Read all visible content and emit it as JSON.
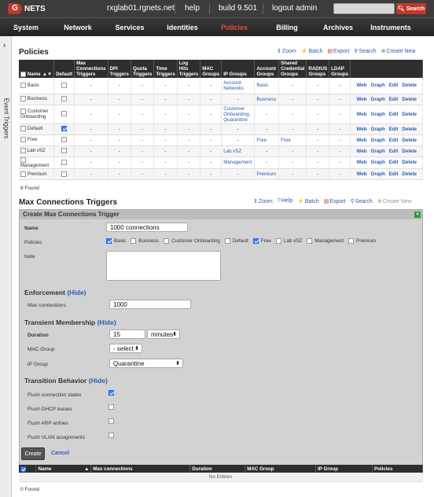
{
  "topbar": {
    "brand_letter": "G",
    "brand_text": "NETS",
    "host": "rxglab01.rgnets.net",
    "help": "help",
    "build": "build 9.501",
    "logout": "logout admin",
    "search_btn": "Search"
  },
  "nav": [
    "System",
    "Network",
    "Services",
    "Identities",
    "Policies",
    "Billing",
    "Archives",
    "Instruments"
  ],
  "nav_active": "Policies",
  "sidetab": {
    "arrow": "›",
    "label": "Event Triggers"
  },
  "policies": {
    "title": "Policies",
    "toolbar": [
      "Zoom",
      "Batch",
      "Export",
      "Search",
      "Create New"
    ],
    "headers": [
      "Name",
      "Default",
      "Max Connections Triggers",
      "DPI Triggers",
      "Quota Triggers",
      "Time Triggers",
      "Log Hits Triggers",
      "MAC Groups",
      "IP Groups",
      "Account Groups",
      "Shared Credential Groups",
      "RADIUS Groups",
      "LDAP Groups"
    ],
    "rows": [
      {
        "name": "Basic",
        "default": false,
        "cells": [
          "-",
          "-",
          "-",
          "-",
          "-",
          "-"
        ],
        "ip": "Account Networks",
        "acct": "Basic",
        "shared": "-",
        "radius": "-",
        "ldap": "-"
      },
      {
        "name": "Business",
        "default": false,
        "cells": [
          "-",
          "-",
          "-",
          "-",
          "-",
          "-"
        ],
        "ip": "-",
        "acct": "Business",
        "shared": "-",
        "radius": "-",
        "ldap": "-"
      },
      {
        "name": "Customer Onboarding",
        "default": false,
        "cells": [
          "-",
          "-",
          "-",
          "-",
          "-",
          "-"
        ],
        "ip": "Customer Onboarding, Quarantine",
        "acct": "-",
        "shared": "-",
        "radius": "-",
        "ldap": "-"
      },
      {
        "name": "Default",
        "default": true,
        "cells": [
          "-",
          "-",
          "-",
          "-",
          "-",
          "-"
        ],
        "ip": "-",
        "acct": "-",
        "shared": "-",
        "radius": "-",
        "ldap": "-"
      },
      {
        "name": "Free",
        "default": false,
        "cells": [
          "-",
          "-",
          "-",
          "-",
          "-",
          "-"
        ],
        "ip": "-",
        "acct": "Free",
        "shared": "Free",
        "radius": "-",
        "ldap": "-"
      },
      {
        "name": "Lab vSZ",
        "default": false,
        "cells": [
          "-",
          "-",
          "-",
          "-",
          "-",
          "-"
        ],
        "ip": "Lab vSZ",
        "acct": "-",
        "shared": "-",
        "radius": "-",
        "ldap": "-"
      },
      {
        "name": "Management",
        "default": false,
        "cells": [
          "-",
          "-",
          "-",
          "-",
          "-",
          "-"
        ],
        "ip": "Management",
        "acct": "-",
        "shared": "-",
        "radius": "-",
        "ldap": "-"
      },
      {
        "name": "Premium",
        "default": false,
        "cells": [
          "-",
          "-",
          "-",
          "-",
          "-",
          "-"
        ],
        "ip": "-",
        "acct": "Premium",
        "shared": "-",
        "radius": "-",
        "ldap": "-"
      }
    ],
    "actions": [
      "Web",
      "Graph",
      "Edit",
      "Delete"
    ],
    "found": "8 Found"
  },
  "mct": {
    "title": "Max Connections Triggers",
    "toolbar": [
      "Zoom",
      "Help",
      "Batch",
      "Export",
      "Search",
      "Create New"
    ],
    "form_title": "Create Max Connections Trigger",
    "name_label": "Name",
    "name_value": "1000 connections",
    "policies_label": "Policies",
    "policy_options": [
      {
        "label": "Basic",
        "checked": true
      },
      {
        "label": "Business",
        "checked": false
      },
      {
        "label": "Customer Onboarding",
        "checked": false
      },
      {
        "label": "Default",
        "checked": false
      },
      {
        "label": "Free",
        "checked": true
      },
      {
        "label": "Lab vSZ",
        "checked": false
      },
      {
        "label": "Management",
        "checked": false
      },
      {
        "label": "Premium",
        "checked": false
      }
    ],
    "note_label": "Note",
    "enforcement_title": "Enforcement",
    "hide": "(Hide)",
    "max_conn_label": "Max connections",
    "max_conn_value": "1000",
    "transient_title": "Transient Membership",
    "duration_label": "Duration",
    "duration_value": "15",
    "duration_unit": "minutes",
    "mac_group_label": "MAC Group",
    "mac_group_value": "- select -",
    "ip_group_label": "IP Group",
    "ip_group_value": "Quarantine",
    "transition_title": "Transition Behavior",
    "flush": [
      {
        "label": "Flush connection states",
        "checked": true
      },
      {
        "label": "Flush DHCP leases",
        "checked": false
      },
      {
        "label": "Flush ARP entries",
        "checked": false
      },
      {
        "label": "Flush VLAN assignments",
        "checked": false
      }
    ],
    "create": "Create",
    "cancel": "Cancel",
    "list_headers": [
      "Name",
      "Max connections",
      "Duration",
      "MAC Group",
      "IP Group",
      "Policies"
    ],
    "no_entries": "No Entries",
    "found": "0 Found"
  },
  "colors": {
    "accent_red": "#c0392b",
    "link_blue": "#2a5db0",
    "header_dark": "#2e2e2e"
  }
}
